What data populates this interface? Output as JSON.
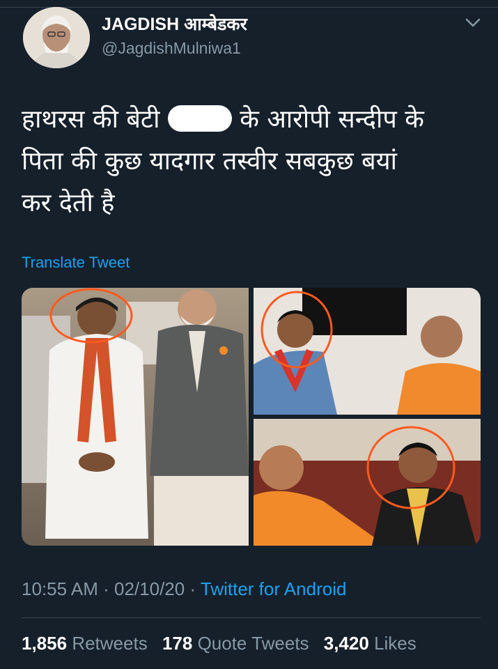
{
  "tweet": {
    "display_name": "JAGDISH आम्बेडकर",
    "handle": "@JagdishMulniwa1",
    "text_line1_pre": "हाथरस की बेटी ",
    "text_line1_post": " के आरोपी सन्दीप के",
    "text_line2": "पिता की कुछ यादगार तस्वीर सबकुछ बयां",
    "text_line3": "कर देती है",
    "translate_label": "Translate Tweet",
    "time": "10:55 AM",
    "date": "02/10/20",
    "separator": "·",
    "source": "Twitter for Android"
  },
  "stats": {
    "retweets_count": "1,856",
    "retweets_label": "Retweets",
    "quotes_count": "178",
    "quotes_label": "Quote Tweets",
    "likes_count": "3,420",
    "likes_label": "Likes"
  },
  "icons": {
    "menu": "chevron-down-icon"
  },
  "colors": {
    "background": "#15202b",
    "primary_text": "#ffffff",
    "secondary_text": "#8899a6",
    "link": "#1da1f2",
    "divider": "#38444d",
    "annotation_circle": "#ff5a1f"
  }
}
